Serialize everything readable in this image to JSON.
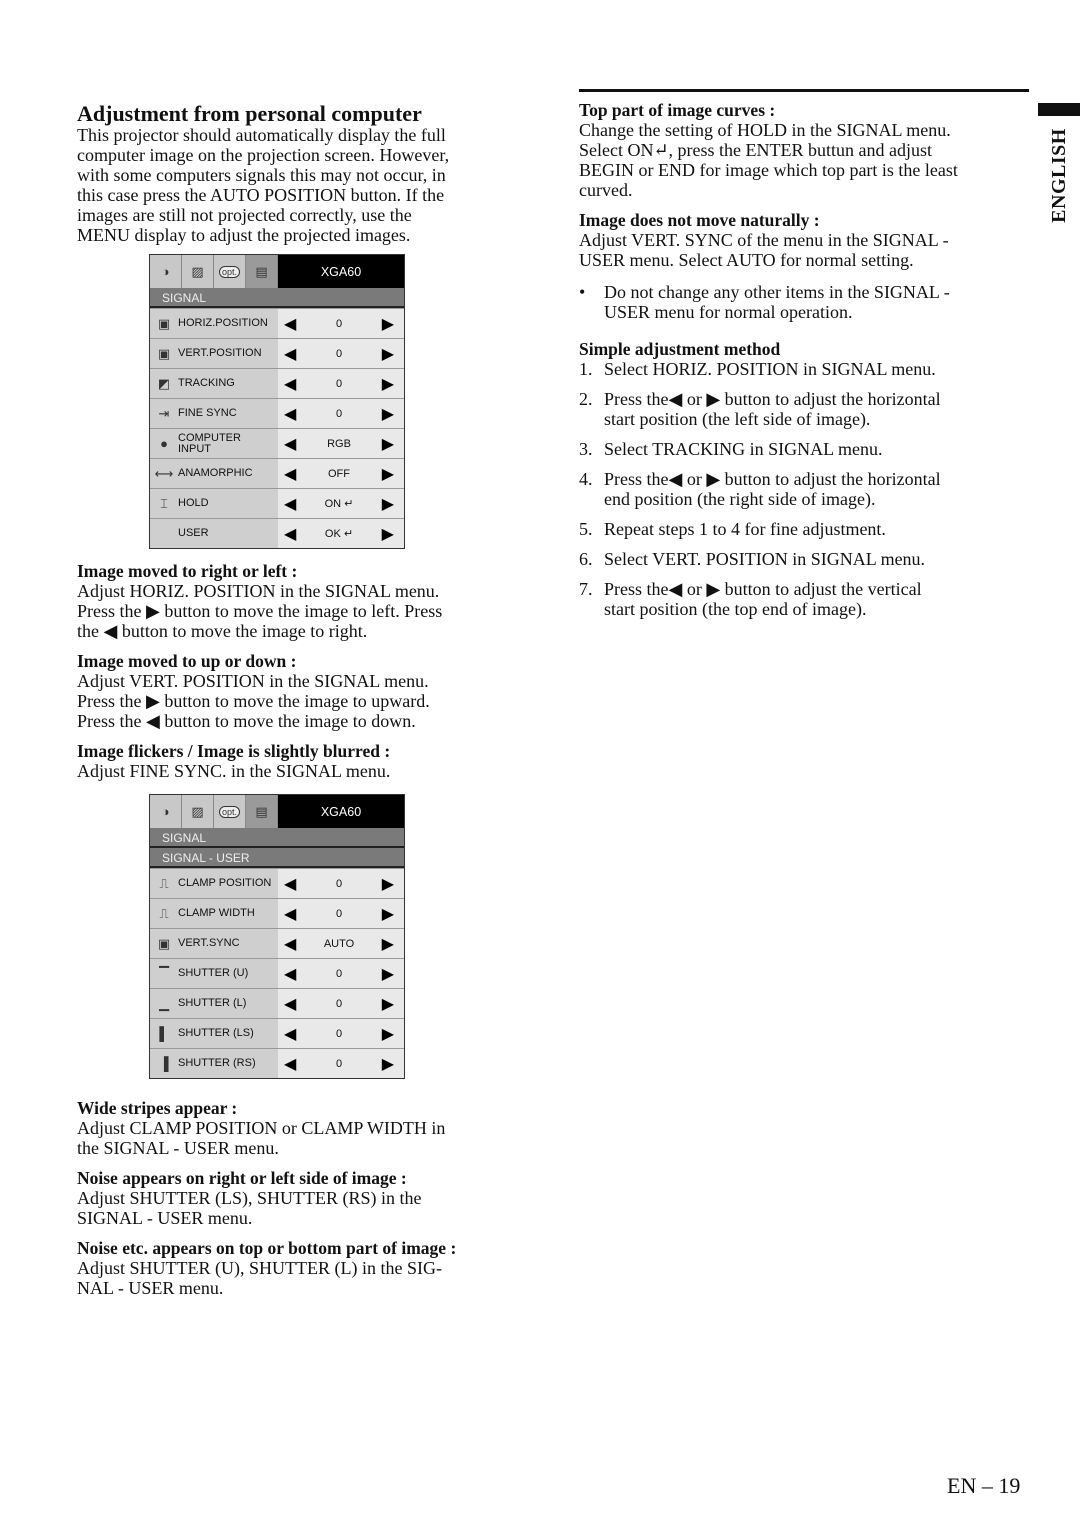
{
  "title": "Adjustment from personal computer",
  "intro": [
    "This projector should automatically display the full",
    "computer image on the projection screen. However,",
    "with some computers signals this may not occur, in",
    "this case press the AUTO POSITION button. If the",
    "images are still not projected correctly, use the",
    "MENU display to adjust the projected images."
  ],
  "menu1": {
    "model": "XGA60",
    "tab_icons": [
      "brightness-icon",
      "image-icon",
      "opt-icon",
      "signal-icon"
    ],
    "opt_label": "opt.",
    "bars": [
      "SIGNAL"
    ],
    "rows": [
      {
        "icon": "▣",
        "label": "HORIZ.POSITION",
        "value": "0"
      },
      {
        "icon": "▣",
        "label": "VERT.POSITION",
        "value": "0"
      },
      {
        "icon": "◩",
        "label": "TRACKING",
        "value": "0"
      },
      {
        "icon": "⇥",
        "label": "FINE SYNC",
        "value": "0"
      },
      {
        "icon": "●",
        "label": "COMPUTER INPUT",
        "value": "RGB"
      },
      {
        "icon": "⟷",
        "label": "ANAMORPHIC",
        "value": "OFF"
      },
      {
        "icon": "⌶",
        "label": "HOLD",
        "value": "ON ↵"
      },
      {
        "icon": "",
        "label": "USER",
        "value": "OK ↵"
      }
    ]
  },
  "left_sections": [
    {
      "heading": "Image moved to right or left :",
      "lines": [
        "Adjust HORIZ. POSITION in the SIGNAL menu.",
        "Press the ▶ button to move the image to left.  Press",
        "the ◀ button to move the image to right."
      ]
    },
    {
      "heading": "Image moved to up or down :",
      "lines": [
        "Adjust VERT. POSITION in the SIGNAL menu.",
        "Press the ▶ button to move the image to upward.",
        "Press the ◀ button to move the image to down."
      ]
    },
    {
      "heading": "Image flickers / Image is slightly blurred :",
      "lines": [
        "Adjust FINE SYNC. in the SIGNAL menu."
      ]
    }
  ],
  "menu2": {
    "model": "XGA60",
    "opt_label": "opt.",
    "bars": [
      "SIGNAL",
      "SIGNAL - USER"
    ],
    "rows": [
      {
        "icon": "⎍",
        "label": "CLAMP POSITION",
        "value": "0"
      },
      {
        "icon": "⎍",
        "label": "CLAMP WIDTH",
        "value": "0"
      },
      {
        "icon": "▣",
        "label": "VERT.SYNC",
        "value": "AUTO"
      },
      {
        "icon": "▔",
        "label": "SHUTTER (U)",
        "value": "0"
      },
      {
        "icon": "▁",
        "label": "SHUTTER (L)",
        "value": "0"
      },
      {
        "icon": "▌",
        "label": "SHUTTER (LS)",
        "value": "0"
      },
      {
        "icon": "▐",
        "label": "SHUTTER (RS)",
        "value": "0"
      }
    ]
  },
  "left_sections2": [
    {
      "heading": "Wide stripes appear :",
      "lines": [
        "Adjust CLAMP POSITION or CLAMP WIDTH in",
        "the SIGNAL - USER menu."
      ]
    },
    {
      "heading": "Noise appears on right or left side of image :",
      "lines": [
        "Adjust SHUTTER (LS), SHUTTER (RS) in the",
        "SIGNAL - USER menu."
      ]
    },
    {
      "heading": "Noise etc. appears on top or bottom part of image :",
      "lines": [
        "Adjust SHUTTER (U), SHUTTER (L) in the SIG-",
        "NAL - USER menu."
      ]
    }
  ],
  "right_sections": [
    {
      "heading": "Top part of image curves :",
      "lines": [
        "Change the setting of HOLD in the SIGNAL menu.",
        "Select ON↵,  press the ENTER buttun and adjust",
        "BEGIN or END for image which top part is the least",
        "curved."
      ]
    },
    {
      "heading": "Image does not move naturally :",
      "lines": [
        "Adjust VERT. SYNC of the menu in the SIGNAL -",
        "USER menu.  Select AUTO for normal setting."
      ]
    }
  ],
  "bullet": {
    "mark": "•",
    "lines": [
      "Do not change any other items in the SIGNAL -",
      "USER menu for normal operation."
    ]
  },
  "method": {
    "heading": "Simple adjustment method",
    "steps": [
      {
        "n": "1.",
        "lines": [
          "Select HORIZ. POSITION in SIGNAL menu."
        ]
      },
      {
        "n": "2.",
        "lines": [
          "Press the◀ or ▶ button to adjust the horizontal",
          "start position (the left side of image)."
        ]
      },
      {
        "n": "3.",
        "lines": [
          "Select TRACKING in SIGNAL menu."
        ]
      },
      {
        "n": "4.",
        "lines": [
          "Press the◀ or ▶ button to adjust the horizontal",
          "end position (the right side of image)."
        ]
      },
      {
        "n": "5.",
        "lines": [
          "Repeat steps 1 to 4 for fine adjustment."
        ]
      },
      {
        "n": "6.",
        "lines": [
          "Select VERT. POSITION in SIGNAL menu."
        ]
      },
      {
        "n": "7.",
        "lines": [
          "Press the◀ or ▶ button to adjust the vertical",
          "start position (the top end of image)."
        ]
      }
    ]
  },
  "language_tab": "ENGLISH",
  "page_number": "EN – 19"
}
